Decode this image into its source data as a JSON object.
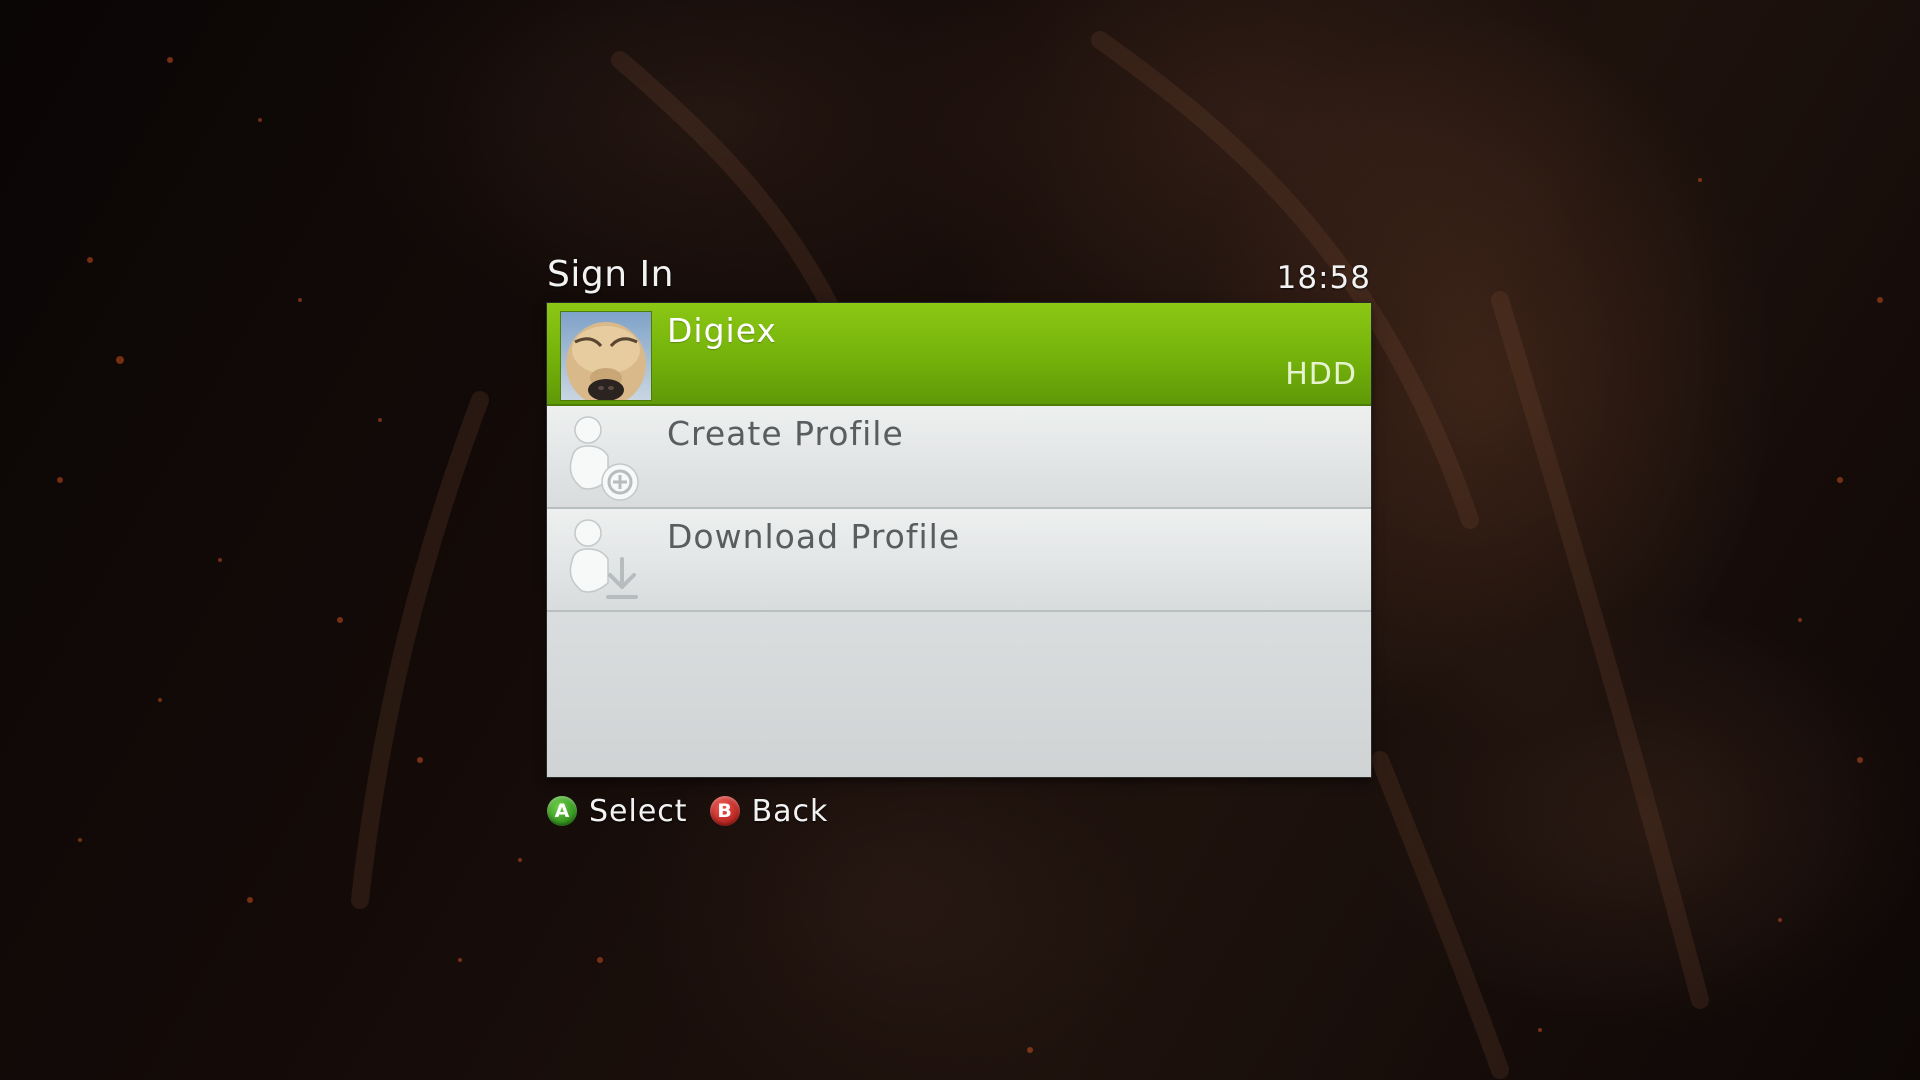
{
  "dialog": {
    "title": "Sign In",
    "clock": "18:58"
  },
  "profiles": [
    {
      "label": "Digiex",
      "storage": "HDD",
      "icon": "gamerpic-dog-avatar",
      "selected": true
    },
    {
      "label": "Create Profile",
      "icon": "create-profile-icon",
      "selected": false
    },
    {
      "label": "Download Profile",
      "icon": "download-profile-icon",
      "selected": false
    }
  ],
  "footer": {
    "select_glyph": "A",
    "select_label": "Select",
    "back_glyph": "B",
    "back_label": "Back"
  },
  "colors": {
    "selected_row": "#74b20a",
    "panel": "#dcdfe0",
    "button_a": "#2e8e1a",
    "button_b": "#b3211c"
  }
}
